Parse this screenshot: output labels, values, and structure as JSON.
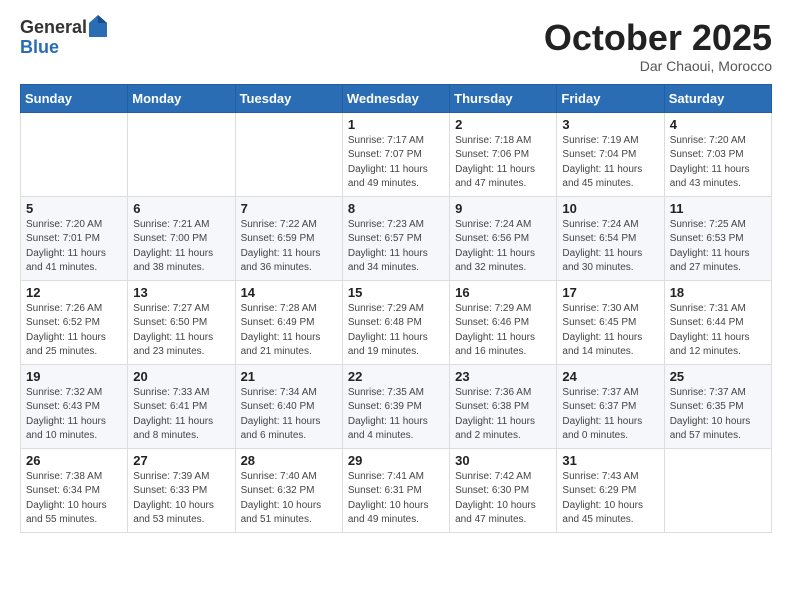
{
  "header": {
    "logo_general": "General",
    "logo_blue": "Blue",
    "month": "October 2025",
    "location": "Dar Chaoui, Morocco"
  },
  "weekdays": [
    "Sunday",
    "Monday",
    "Tuesday",
    "Wednesday",
    "Thursday",
    "Friday",
    "Saturday"
  ],
  "weeks": [
    [
      {
        "day": "",
        "info": ""
      },
      {
        "day": "",
        "info": ""
      },
      {
        "day": "",
        "info": ""
      },
      {
        "day": "1",
        "info": "Sunrise: 7:17 AM\nSunset: 7:07 PM\nDaylight: 11 hours\nand 49 minutes."
      },
      {
        "day": "2",
        "info": "Sunrise: 7:18 AM\nSunset: 7:06 PM\nDaylight: 11 hours\nand 47 minutes."
      },
      {
        "day": "3",
        "info": "Sunrise: 7:19 AM\nSunset: 7:04 PM\nDaylight: 11 hours\nand 45 minutes."
      },
      {
        "day": "4",
        "info": "Sunrise: 7:20 AM\nSunset: 7:03 PM\nDaylight: 11 hours\nand 43 minutes."
      }
    ],
    [
      {
        "day": "5",
        "info": "Sunrise: 7:20 AM\nSunset: 7:01 PM\nDaylight: 11 hours\nand 41 minutes."
      },
      {
        "day": "6",
        "info": "Sunrise: 7:21 AM\nSunset: 7:00 PM\nDaylight: 11 hours\nand 38 minutes."
      },
      {
        "day": "7",
        "info": "Sunrise: 7:22 AM\nSunset: 6:59 PM\nDaylight: 11 hours\nand 36 minutes."
      },
      {
        "day": "8",
        "info": "Sunrise: 7:23 AM\nSunset: 6:57 PM\nDaylight: 11 hours\nand 34 minutes."
      },
      {
        "day": "9",
        "info": "Sunrise: 7:24 AM\nSunset: 6:56 PM\nDaylight: 11 hours\nand 32 minutes."
      },
      {
        "day": "10",
        "info": "Sunrise: 7:24 AM\nSunset: 6:54 PM\nDaylight: 11 hours\nand 30 minutes."
      },
      {
        "day": "11",
        "info": "Sunrise: 7:25 AM\nSunset: 6:53 PM\nDaylight: 11 hours\nand 27 minutes."
      }
    ],
    [
      {
        "day": "12",
        "info": "Sunrise: 7:26 AM\nSunset: 6:52 PM\nDaylight: 11 hours\nand 25 minutes."
      },
      {
        "day": "13",
        "info": "Sunrise: 7:27 AM\nSunset: 6:50 PM\nDaylight: 11 hours\nand 23 minutes."
      },
      {
        "day": "14",
        "info": "Sunrise: 7:28 AM\nSunset: 6:49 PM\nDaylight: 11 hours\nand 21 minutes."
      },
      {
        "day": "15",
        "info": "Sunrise: 7:29 AM\nSunset: 6:48 PM\nDaylight: 11 hours\nand 19 minutes."
      },
      {
        "day": "16",
        "info": "Sunrise: 7:29 AM\nSunset: 6:46 PM\nDaylight: 11 hours\nand 16 minutes."
      },
      {
        "day": "17",
        "info": "Sunrise: 7:30 AM\nSunset: 6:45 PM\nDaylight: 11 hours\nand 14 minutes."
      },
      {
        "day": "18",
        "info": "Sunrise: 7:31 AM\nSunset: 6:44 PM\nDaylight: 11 hours\nand 12 minutes."
      }
    ],
    [
      {
        "day": "19",
        "info": "Sunrise: 7:32 AM\nSunset: 6:43 PM\nDaylight: 11 hours\nand 10 minutes."
      },
      {
        "day": "20",
        "info": "Sunrise: 7:33 AM\nSunset: 6:41 PM\nDaylight: 11 hours\nand 8 minutes."
      },
      {
        "day": "21",
        "info": "Sunrise: 7:34 AM\nSunset: 6:40 PM\nDaylight: 11 hours\nand 6 minutes."
      },
      {
        "day": "22",
        "info": "Sunrise: 7:35 AM\nSunset: 6:39 PM\nDaylight: 11 hours\nand 4 minutes."
      },
      {
        "day": "23",
        "info": "Sunrise: 7:36 AM\nSunset: 6:38 PM\nDaylight: 11 hours\nand 2 minutes."
      },
      {
        "day": "24",
        "info": "Sunrise: 7:37 AM\nSunset: 6:37 PM\nDaylight: 11 hours\nand 0 minutes."
      },
      {
        "day": "25",
        "info": "Sunrise: 7:37 AM\nSunset: 6:35 PM\nDaylight: 10 hours\nand 57 minutes."
      }
    ],
    [
      {
        "day": "26",
        "info": "Sunrise: 7:38 AM\nSunset: 6:34 PM\nDaylight: 10 hours\nand 55 minutes."
      },
      {
        "day": "27",
        "info": "Sunrise: 7:39 AM\nSunset: 6:33 PM\nDaylight: 10 hours\nand 53 minutes."
      },
      {
        "day": "28",
        "info": "Sunrise: 7:40 AM\nSunset: 6:32 PM\nDaylight: 10 hours\nand 51 minutes."
      },
      {
        "day": "29",
        "info": "Sunrise: 7:41 AM\nSunset: 6:31 PM\nDaylight: 10 hours\nand 49 minutes."
      },
      {
        "day": "30",
        "info": "Sunrise: 7:42 AM\nSunset: 6:30 PM\nDaylight: 10 hours\nand 47 minutes."
      },
      {
        "day": "31",
        "info": "Sunrise: 7:43 AM\nSunset: 6:29 PM\nDaylight: 10 hours\nand 45 minutes."
      },
      {
        "day": "",
        "info": ""
      }
    ]
  ]
}
